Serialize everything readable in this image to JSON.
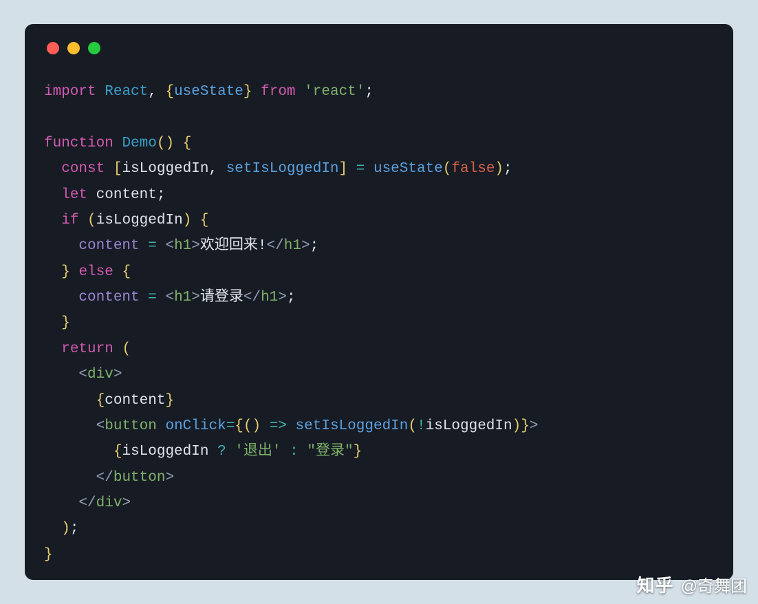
{
  "colors": {
    "outerBg": "#d4e0e8",
    "editorBg": "#171b24",
    "trafficRed": "#ff5f56",
    "trafficYellow": "#ffbd2e",
    "trafficGreen": "#27c93f",
    "keyword": "#d25ab0",
    "className": "#37a0c9",
    "funcName": "#5aa2e0",
    "bracket": "#e9cf6d",
    "string": "#7eb36a",
    "boolean": "#d9604c",
    "angle": "#94a0b6",
    "operator": "#3fb6b0",
    "attr": "#9b86d4",
    "text": "#e3e6ec"
  },
  "tok": {
    "import": "import",
    "React": "React",
    "useState": "useState",
    "from": "from",
    "reactStr": "'react'",
    "function": "function",
    "Demo": "Demo",
    "const": "const",
    "isLoggedIn": "isLoggedIn",
    "setIsLoggedIn": "setIsLoggedIn",
    "false": "false",
    "let": "let",
    "content": "content",
    "if": "if",
    "else": "else",
    "h1": "h1",
    "welcome": "欢迎回来!",
    "pleaseLogin": "请登录",
    "return": "return",
    "div": "div",
    "button": "button",
    "onClick": "onClick",
    "logout": "'退出'",
    "login": "\"登录\""
  },
  "watermark": {
    "logo": "知乎",
    "author": "@奇舞团"
  }
}
